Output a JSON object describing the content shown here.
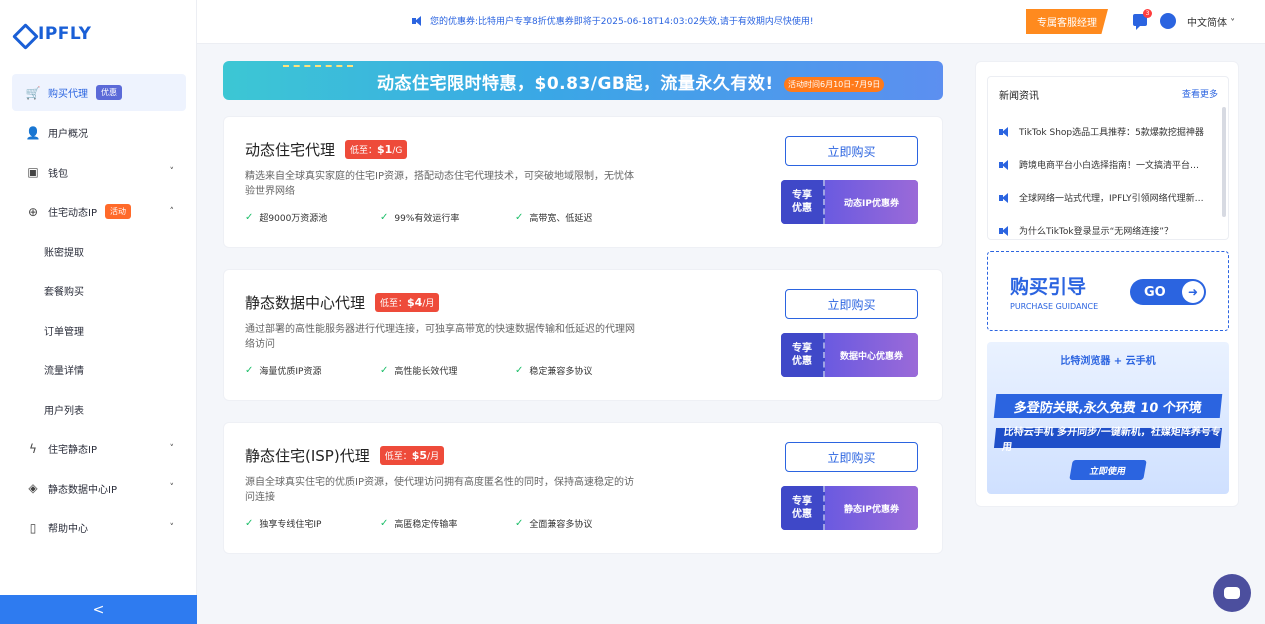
{
  "brand": {
    "logo_text": "IPFLY"
  },
  "sidebar": {
    "items": [
      {
        "label": "购买代理",
        "badge": "优惠",
        "icon": "cart-icon",
        "active": true
      },
      {
        "label": "用户概况",
        "icon": "user-icon"
      },
      {
        "label": "钱包",
        "icon": "wallet-icon",
        "chevron": "˅"
      },
      {
        "label": "住宅动态IP",
        "badge": "活动",
        "icon": "globe-icon",
        "chevron": "˄"
      },
      {
        "label": "账密提取",
        "sub": true
      },
      {
        "label": "套餐购买",
        "sub": true
      },
      {
        "label": "订单管理",
        "sub": true
      },
      {
        "label": "流量详情",
        "sub": true
      },
      {
        "label": "用户列表",
        "sub": true
      },
      {
        "label": "住宅静态IP",
        "icon": "bolt-icon",
        "chevron": "˅"
      },
      {
        "label": "静态数据中心IP",
        "icon": "cube-icon",
        "chevron": "˅"
      },
      {
        "label": "帮助中心",
        "icon": "book-icon",
        "chevron": "˅"
      }
    ],
    "collapse_glyph": "<"
  },
  "topbar": {
    "notice": "您的优惠券:比特用户专享8折优惠券即将于2025-06-18T14:03:02失效,请于有效期内尽快使用!",
    "cs_button": "专属客服经理",
    "msg_count": "3",
    "language": "中文简体 ˅"
  },
  "banner": {
    "text": "动态住宅限时特惠，$0.83/GB起，流量永久有效!",
    "tag": "活动时间6月10日-7月9日"
  },
  "cards": [
    {
      "title": "动态住宅代理",
      "price_prefix": "低至：",
      "price": "$1",
      "price_unit": "/G",
      "desc": "精选来自全球真实家庭的住宅IP资源，搭配动态住宅代理技术，可突破地域限制，无忧体验世界网络",
      "features": [
        "超9000万资源池",
        "99%有效运行率",
        "高带宽、低延迟"
      ],
      "buy_label": "立即购买",
      "coupon_left": "专享\n优惠",
      "coupon_right": "动态IP优惠券"
    },
    {
      "title": "静态数据中心代理",
      "price_prefix": "低至：",
      "price": "$4",
      "price_unit": "/月",
      "desc": "通过部署的高性能服务器进行代理连接，可独享高带宽的快速数据传输和低延迟的代理网络访问",
      "features": [
        "海量优质IP资源",
        "高性能长效代理",
        "稳定兼容多协议"
      ],
      "buy_label": "立即购买",
      "coupon_left": "专享\n优惠",
      "coupon_right": "数据中心优惠券"
    },
    {
      "title": "静态住宅(ISP)代理",
      "price_prefix": "低至：",
      "price": "$5",
      "price_unit": "/月",
      "desc": "源自全球真实住宅的优质IP资源，使代理访问拥有高度匿名性的同时，保持高速稳定的访问连接",
      "features": [
        "独享专线住宅IP",
        "高匿稳定传输率",
        "全面兼容多协议"
      ],
      "buy_label": "立即购买",
      "coupon_left": "专享\n优惠",
      "coupon_right": "静态IP优惠券"
    }
  ],
  "news": {
    "title": "新闻资讯",
    "more": "查看更多",
    "items": [
      "TikTok Shop选品工具推荐：5款爆款挖掘神器",
      "跨境电商平台小白选择指南！一文搞清平台…",
      "全球网络一站式代理，IPFLY引领网络代理新…",
      "为什么TikTok登录显示“无网络连接”？"
    ]
  },
  "guide": {
    "title": "购买引导",
    "subtitle": "PURCHASE GUIDANCE",
    "go": "GO"
  },
  "promo": {
    "brand": "比特浏览器 + 云手机",
    "line1": "多登防关联,永久免费 10 个环境",
    "line2": "比特云手机 多开同步/一键新机，社媒矩阵养号专用",
    "button": "立即使用"
  }
}
